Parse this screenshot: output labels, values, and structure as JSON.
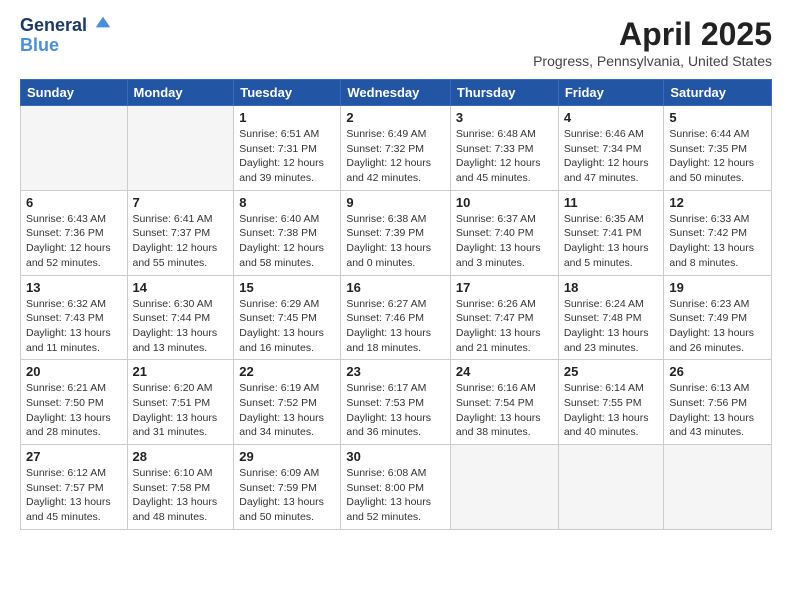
{
  "header": {
    "logo_line1": "General",
    "logo_line2": "Blue",
    "month_title": "April 2025",
    "subtitle": "Progress, Pennsylvania, United States"
  },
  "days_of_week": [
    "Sunday",
    "Monday",
    "Tuesday",
    "Wednesday",
    "Thursday",
    "Friday",
    "Saturday"
  ],
  "weeks": [
    [
      {
        "day": "",
        "info": ""
      },
      {
        "day": "",
        "info": ""
      },
      {
        "day": "1",
        "info": "Sunrise: 6:51 AM\nSunset: 7:31 PM\nDaylight: 12 hours and 39 minutes."
      },
      {
        "day": "2",
        "info": "Sunrise: 6:49 AM\nSunset: 7:32 PM\nDaylight: 12 hours and 42 minutes."
      },
      {
        "day": "3",
        "info": "Sunrise: 6:48 AM\nSunset: 7:33 PM\nDaylight: 12 hours and 45 minutes."
      },
      {
        "day": "4",
        "info": "Sunrise: 6:46 AM\nSunset: 7:34 PM\nDaylight: 12 hours and 47 minutes."
      },
      {
        "day": "5",
        "info": "Sunrise: 6:44 AM\nSunset: 7:35 PM\nDaylight: 12 hours and 50 minutes."
      }
    ],
    [
      {
        "day": "6",
        "info": "Sunrise: 6:43 AM\nSunset: 7:36 PM\nDaylight: 12 hours and 52 minutes."
      },
      {
        "day": "7",
        "info": "Sunrise: 6:41 AM\nSunset: 7:37 PM\nDaylight: 12 hours and 55 minutes."
      },
      {
        "day": "8",
        "info": "Sunrise: 6:40 AM\nSunset: 7:38 PM\nDaylight: 12 hours and 58 minutes."
      },
      {
        "day": "9",
        "info": "Sunrise: 6:38 AM\nSunset: 7:39 PM\nDaylight: 13 hours and 0 minutes."
      },
      {
        "day": "10",
        "info": "Sunrise: 6:37 AM\nSunset: 7:40 PM\nDaylight: 13 hours and 3 minutes."
      },
      {
        "day": "11",
        "info": "Sunrise: 6:35 AM\nSunset: 7:41 PM\nDaylight: 13 hours and 5 minutes."
      },
      {
        "day": "12",
        "info": "Sunrise: 6:33 AM\nSunset: 7:42 PM\nDaylight: 13 hours and 8 minutes."
      }
    ],
    [
      {
        "day": "13",
        "info": "Sunrise: 6:32 AM\nSunset: 7:43 PM\nDaylight: 13 hours and 11 minutes."
      },
      {
        "day": "14",
        "info": "Sunrise: 6:30 AM\nSunset: 7:44 PM\nDaylight: 13 hours and 13 minutes."
      },
      {
        "day": "15",
        "info": "Sunrise: 6:29 AM\nSunset: 7:45 PM\nDaylight: 13 hours and 16 minutes."
      },
      {
        "day": "16",
        "info": "Sunrise: 6:27 AM\nSunset: 7:46 PM\nDaylight: 13 hours and 18 minutes."
      },
      {
        "day": "17",
        "info": "Sunrise: 6:26 AM\nSunset: 7:47 PM\nDaylight: 13 hours and 21 minutes."
      },
      {
        "day": "18",
        "info": "Sunrise: 6:24 AM\nSunset: 7:48 PM\nDaylight: 13 hours and 23 minutes."
      },
      {
        "day": "19",
        "info": "Sunrise: 6:23 AM\nSunset: 7:49 PM\nDaylight: 13 hours and 26 minutes."
      }
    ],
    [
      {
        "day": "20",
        "info": "Sunrise: 6:21 AM\nSunset: 7:50 PM\nDaylight: 13 hours and 28 minutes."
      },
      {
        "day": "21",
        "info": "Sunrise: 6:20 AM\nSunset: 7:51 PM\nDaylight: 13 hours and 31 minutes."
      },
      {
        "day": "22",
        "info": "Sunrise: 6:19 AM\nSunset: 7:52 PM\nDaylight: 13 hours and 34 minutes."
      },
      {
        "day": "23",
        "info": "Sunrise: 6:17 AM\nSunset: 7:53 PM\nDaylight: 13 hours and 36 minutes."
      },
      {
        "day": "24",
        "info": "Sunrise: 6:16 AM\nSunset: 7:54 PM\nDaylight: 13 hours and 38 minutes."
      },
      {
        "day": "25",
        "info": "Sunrise: 6:14 AM\nSunset: 7:55 PM\nDaylight: 13 hours and 40 minutes."
      },
      {
        "day": "26",
        "info": "Sunrise: 6:13 AM\nSunset: 7:56 PM\nDaylight: 13 hours and 43 minutes."
      }
    ],
    [
      {
        "day": "27",
        "info": "Sunrise: 6:12 AM\nSunset: 7:57 PM\nDaylight: 13 hours and 45 minutes."
      },
      {
        "day": "28",
        "info": "Sunrise: 6:10 AM\nSunset: 7:58 PM\nDaylight: 13 hours and 48 minutes."
      },
      {
        "day": "29",
        "info": "Sunrise: 6:09 AM\nSunset: 7:59 PM\nDaylight: 13 hours and 50 minutes."
      },
      {
        "day": "30",
        "info": "Sunrise: 6:08 AM\nSunset: 8:00 PM\nDaylight: 13 hours and 52 minutes."
      },
      {
        "day": "",
        "info": ""
      },
      {
        "day": "",
        "info": ""
      },
      {
        "day": "",
        "info": ""
      }
    ]
  ]
}
